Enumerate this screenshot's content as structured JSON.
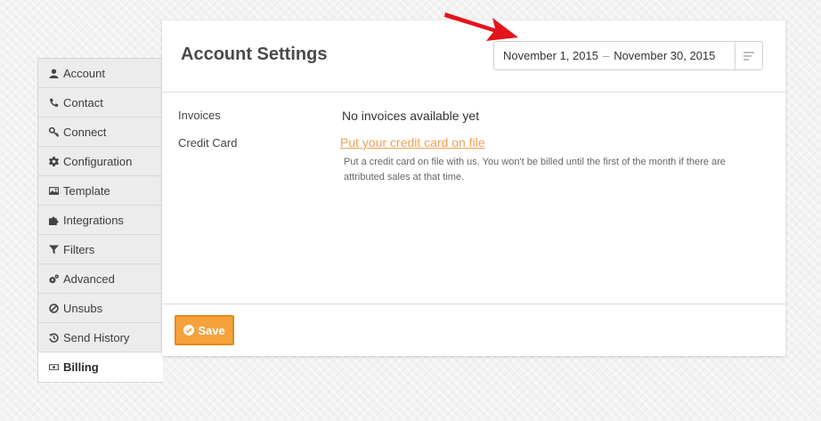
{
  "sidebar": {
    "items": [
      {
        "label": "Account",
        "icon": "user-icon"
      },
      {
        "label": "Contact",
        "icon": "phone-icon"
      },
      {
        "label": "Connect",
        "icon": "key-icon"
      },
      {
        "label": "Configuration",
        "icon": "gear-icon"
      },
      {
        "label": "Template",
        "icon": "picture-icon"
      },
      {
        "label": "Integrations",
        "icon": "puzzle-icon"
      },
      {
        "label": "Filters",
        "icon": "filter-icon"
      },
      {
        "label": "Advanced",
        "icon": "cogs-icon"
      },
      {
        "label": "Unsubs",
        "icon": "ban-icon"
      },
      {
        "label": "Send History",
        "icon": "history-icon"
      },
      {
        "label": "Billing",
        "icon": "money-icon",
        "active": true
      }
    ]
  },
  "header": {
    "title": "Account Settings",
    "date_range": {
      "start": "November 1, 2015",
      "separator": "–",
      "end": "November 30, 2015"
    }
  },
  "billing": {
    "invoices_label": "Invoices",
    "invoices_value": "No invoices available yet",
    "credit_card_label": "Credit Card",
    "credit_card_link": "Put your credit card on file",
    "credit_card_note": "Put a credit card on file with us. You won't be billed until the first of the month if there are attributed sales at that time."
  },
  "footer": {
    "save_label": "Save"
  },
  "colors": {
    "accent": "#f5a23d",
    "link": "#f0a054",
    "annotation_arrow": "#e3141c"
  }
}
